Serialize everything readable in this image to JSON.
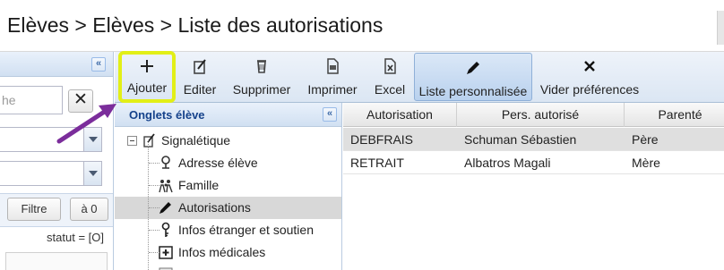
{
  "breadcrumb": {
    "text": "Elèves > Elèves > Liste des autorisations"
  },
  "left_panel": {
    "search_placeholder": "he",
    "clear_label": "✕",
    "filter_label": "Filtre",
    "reset_label": "à 0",
    "status_text": "statut = [O]"
  },
  "toolbar": {
    "ajouter": "Ajouter",
    "editer": "Editer",
    "supprimer": "Supprimer",
    "imprimer": "Imprimer",
    "excel": "Excel",
    "liste": "Liste personnalisée",
    "vider": "Vider préférences"
  },
  "tree": {
    "title": "Onglets élève",
    "root": "Signalétique",
    "items": [
      {
        "label": "Adresse élève",
        "icon": "map-pin-icon"
      },
      {
        "label": "Famille",
        "icon": "family-icon"
      },
      {
        "label": "Autorisations",
        "icon": "pencil-icon"
      },
      {
        "label": "Infos étranger et soutien",
        "icon": "key-icon"
      },
      {
        "label": "Infos médicales",
        "icon": "medical-icon"
      }
    ],
    "selected": "Autorisations"
  },
  "grid": {
    "columns": [
      "Autorisation",
      "Pers. autorisé",
      "Parenté"
    ],
    "rows": [
      {
        "autorisation": "DEBFRAIS",
        "personne": "Schuman Sébastien",
        "parente": "Père",
        "selected": true
      },
      {
        "autorisation": "RETRAIT",
        "personne": "Albatros Magali",
        "parente": "Mère",
        "selected": false
      }
    ]
  },
  "colors": {
    "highlight_box": "#e2ef17",
    "annotation_arrow": "#7b2d9b",
    "panel_header_text": "#15428b"
  }
}
